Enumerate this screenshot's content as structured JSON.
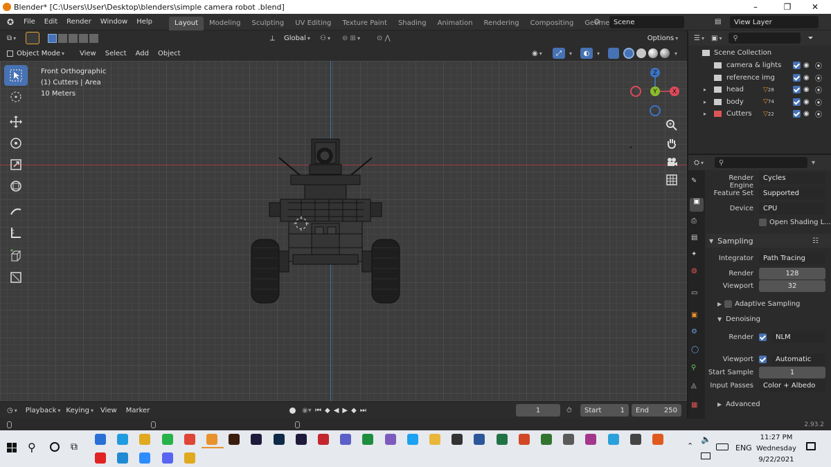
{
  "window": {
    "title": "Blender* [C:\\Users\\User\\Desktop\\blenders\\simple camera robot .blend]",
    "minimize": "–",
    "maximize": "❐",
    "close": "✕"
  },
  "topbar": {
    "menus": [
      "File",
      "Edit",
      "Render",
      "Window",
      "Help"
    ],
    "workspaces": [
      "Layout",
      "Modeling",
      "Sculpting",
      "UV Editing",
      "Texture Paint",
      "Shading",
      "Animation",
      "Rendering",
      "Compositing",
      "Geometry Nod"
    ],
    "scene": "Scene",
    "view_layer": "View Layer"
  },
  "viewport_header": {
    "orientation": "Global",
    "options": "Options",
    "mode": "Object Mode",
    "menus": [
      "View",
      "Select",
      "Add",
      "Object"
    ]
  },
  "viewport": {
    "view_name": "Front Orthographic",
    "collection_line": "(1) Cutters | Area",
    "scale": "10 Meters"
  },
  "gizmo": {
    "z": "Z",
    "y": "Y",
    "x": "X"
  },
  "outliner": {
    "root": "Scene Collection",
    "items": [
      {
        "label": "camera & lights",
        "badge": ""
      },
      {
        "label": "reference img",
        "badge": ""
      },
      {
        "label": "head",
        "badge": "28"
      },
      {
        "label": "body",
        "badge": "74"
      },
      {
        "label": "Cutters",
        "badge": "22"
      }
    ]
  },
  "properties": {
    "render_engine_label": "Render Engine",
    "render_engine": "Cycles",
    "feature_set_label": "Feature Set",
    "feature_set": "Supported",
    "device_label": "Device",
    "device": "CPU",
    "open_shading": "Open Shading L...",
    "sampling": "Sampling",
    "integrator_label": "Integrator",
    "integrator": "Path Tracing",
    "render_label": "Render",
    "render_samples": "128",
    "viewport_label": "Viewport",
    "viewport_samples": "32",
    "adaptive": "Adaptive Sampling",
    "denoising": "Denoising",
    "dn_render_label": "Render",
    "dn_render": "NLM",
    "dn_viewport_label": "Viewport",
    "dn_viewport": "Automatic",
    "start_sample_label": "Start Sample",
    "start_sample": "1",
    "input_passes_label": "Input Passes",
    "input_passes": "Color + Albedo",
    "advanced": "Advanced"
  },
  "timeline": {
    "playback": "Playback",
    "keying": "Keying",
    "view": "View",
    "marker": "Marker",
    "current_frame": "1",
    "start_label": "Start",
    "start": "1",
    "end_label": "End",
    "end": "250"
  },
  "statusbar": {
    "version": "2.93.2"
  },
  "taskbar": {
    "time": "11:27 PM",
    "day": "Wednesday",
    "date": "9/22/2021",
    "lang": "ENG"
  }
}
